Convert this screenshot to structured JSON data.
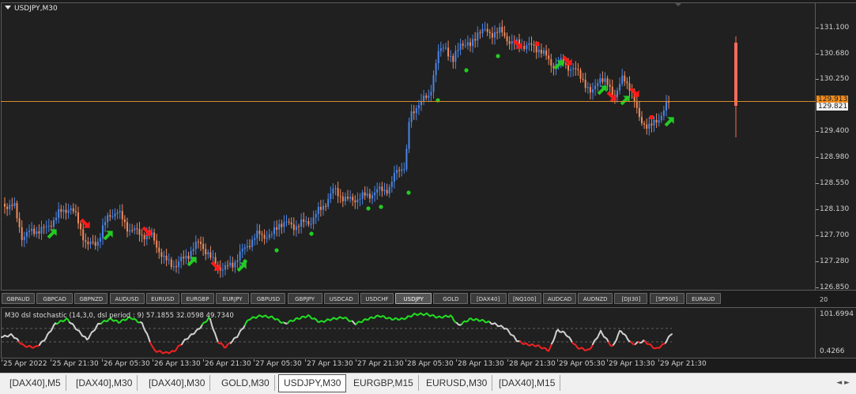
{
  "chart": {
    "title": "USDJPY,M30",
    "price_labels": [
      "131.100",
      "130.680",
      "130.250",
      "129.400",
      "128.980",
      "128.550",
      "128.130",
      "127.700",
      "127.280",
      "126.850"
    ],
    "badge_orange": "129.913",
    "badge_white": "129.821",
    "colors": {
      "bull": "#4a86e8",
      "bear": "#f08a5d",
      "buy_arrow": "#22cc22",
      "sell_arrow": "#ff1a1a",
      "dot": "#22cc22",
      "hline": "#d98b2b"
    }
  },
  "symbols": [
    "GBPAUD",
    "GBPCAD",
    "GBPNZD",
    "AUDUSD",
    "EURUSD",
    "EURGBP",
    "EURJPY",
    "GBPUSD",
    "GBPJPY",
    "USDCAD",
    "USDCHF",
    "USDJPY",
    "GOLD",
    "[DAX40]",
    "[NQ100]",
    "AUDCAD",
    "AUDNZD",
    "[DJI30]",
    "[SP500]",
    "EURAUD"
  ],
  "active_symbol": "USDJPY",
  "indicator": {
    "title": "M30 dsl stochastic (14,3,0, dsl period : 9) 57.1855 32.0598 49.7340",
    "axis_top": "20",
    "axis_high": "101.6994",
    "axis_low": "0.4266"
  },
  "time_labels": [
    "25 Apr 2022",
    "25 Apr 21:30",
    "26 Apr 05:30",
    "26 Apr 13:30",
    "26 Apr 21:30",
    "27 Apr 05:30",
    "27 Apr 13:30",
    "27 Apr 21:30",
    "28 Apr 05:30",
    "28 Apr 13:30",
    "28 Apr 21:30",
    "29 Apr 05:30",
    "29 Apr 13:30",
    "29 Apr 21:30"
  ],
  "tabs": [
    "[DAX40],M5",
    "[DAX40],M30",
    "[DAX40],M30",
    "GOLD,M30",
    "USDJPY,M30",
    "EURGBP,M15",
    "EURUSD,M30",
    "[DAX40],M15"
  ],
  "active_tab": "USDJPY,M30",
  "tab_nav": "◄ ►"
}
